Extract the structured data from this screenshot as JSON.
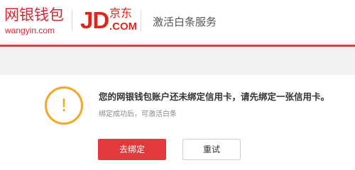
{
  "header": {
    "wangyin_logo": {
      "chinese": "网银钱包",
      "domain": "wangyin.com",
      "color": "#d9232f"
    },
    "jd_logo": {
      "mark": "JD",
      "chinese": "京东",
      "domain": ".COM",
      "color": "#e1251b"
    },
    "page_title": "激活白条服务",
    "accent_color": "#e4393c"
  },
  "notice": {
    "icon": "warning-icon",
    "icon_glyph": "!",
    "icon_color": "#f5a623",
    "message": "您的网银钱包账户还未绑定信用卡，请先绑定一张信用卡。",
    "hint": "绑定成功后，可激活白条"
  },
  "actions": {
    "bind_label": "去绑定",
    "retry_label": "重试"
  }
}
